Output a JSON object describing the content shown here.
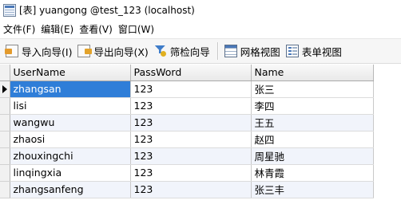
{
  "window": {
    "title": "[表] yuangong @test_123 (localhost)",
    "app_icon": "table-icon"
  },
  "menu": {
    "items": [
      {
        "label": "文件(F)"
      },
      {
        "label": "编辑(E)"
      },
      {
        "label": "查看(V)"
      },
      {
        "label": "窗口(W)"
      }
    ]
  },
  "toolbar": {
    "import_label": "导入向导(I)",
    "import_icon": "import-icon",
    "export_label": "导出向导(X)",
    "export_icon": "export-icon",
    "filter_label": "筛检向导",
    "filter_icon": "filter-icon",
    "grid_view_label": "网格视图",
    "grid_view_icon": "grid-view-icon",
    "form_view_label": "表单视图",
    "form_view_icon": "form-view-icon"
  },
  "grid": {
    "columns": [
      "UserName",
      "PassWord",
      "Name"
    ],
    "rows": [
      {
        "username": "zhangsan",
        "password": "123",
        "name": "张三"
      },
      {
        "username": "lisi",
        "password": "123",
        "name": "李四"
      },
      {
        "username": "wangwu",
        "password": "123",
        "name": "王五"
      },
      {
        "username": "zhaosi",
        "password": "123",
        "name": "赵四"
      },
      {
        "username": "zhouxingchi",
        "password": "123",
        "name": "周星驰"
      },
      {
        "username": "linqingxia",
        "password": "123",
        "name": "林青霞"
      },
      {
        "username": "zhangsanfeng",
        "password": "123",
        "name": "张三丰"
      }
    ],
    "current_row_indicator": "row-pointer-icon",
    "selection_color": "#2f7ed8",
    "alt_row_color": "#f1f4fb"
  }
}
